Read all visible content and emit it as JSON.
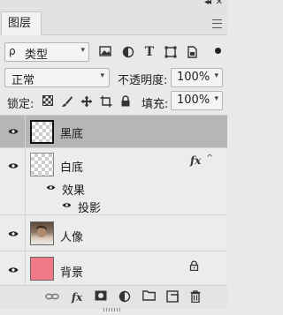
{
  "panel": {
    "tab_label": "图层",
    "collapse_glyph": "◂◂",
    "close_glyph": "✕"
  },
  "filter": {
    "kind_label": "类型",
    "search_glyph": "ρ",
    "dropdown_glyph": "▾",
    "icons": [
      "image-filter-icon",
      "adjustment-filter-icon",
      "type-filter-icon",
      "shape-filter-icon",
      "smart-object-filter-icon"
    ],
    "type_glyph": "T"
  },
  "blend": {
    "mode": "正常",
    "opacity_label": "不透明度:",
    "opacity_value": "100%",
    "lock_label": "锁定:",
    "fill_label": "填充:",
    "fill_value": "100%"
  },
  "layers": [
    {
      "name": "黑底",
      "selected": true,
      "thumb": "transparent"
    },
    {
      "name": "白底",
      "selected": false,
      "thumb": "transparent",
      "fx": "fx",
      "effects_label": "效果",
      "effect_items": [
        "投影"
      ]
    },
    {
      "name": "人像",
      "selected": false,
      "thumb": "portrait"
    },
    {
      "name": "背景",
      "selected": false,
      "thumb": "pink",
      "locked": true
    }
  ],
  "footer": {
    "fx_label": "fx",
    "icons": [
      "link-layers-icon",
      "fx-icon",
      "mask-icon",
      "adjustment-icon",
      "folder-icon",
      "new-layer-icon",
      "trash-icon"
    ]
  },
  "colors": {
    "selected_row": "#b6b6b6",
    "background_layer_fill": "#f07a86"
  }
}
